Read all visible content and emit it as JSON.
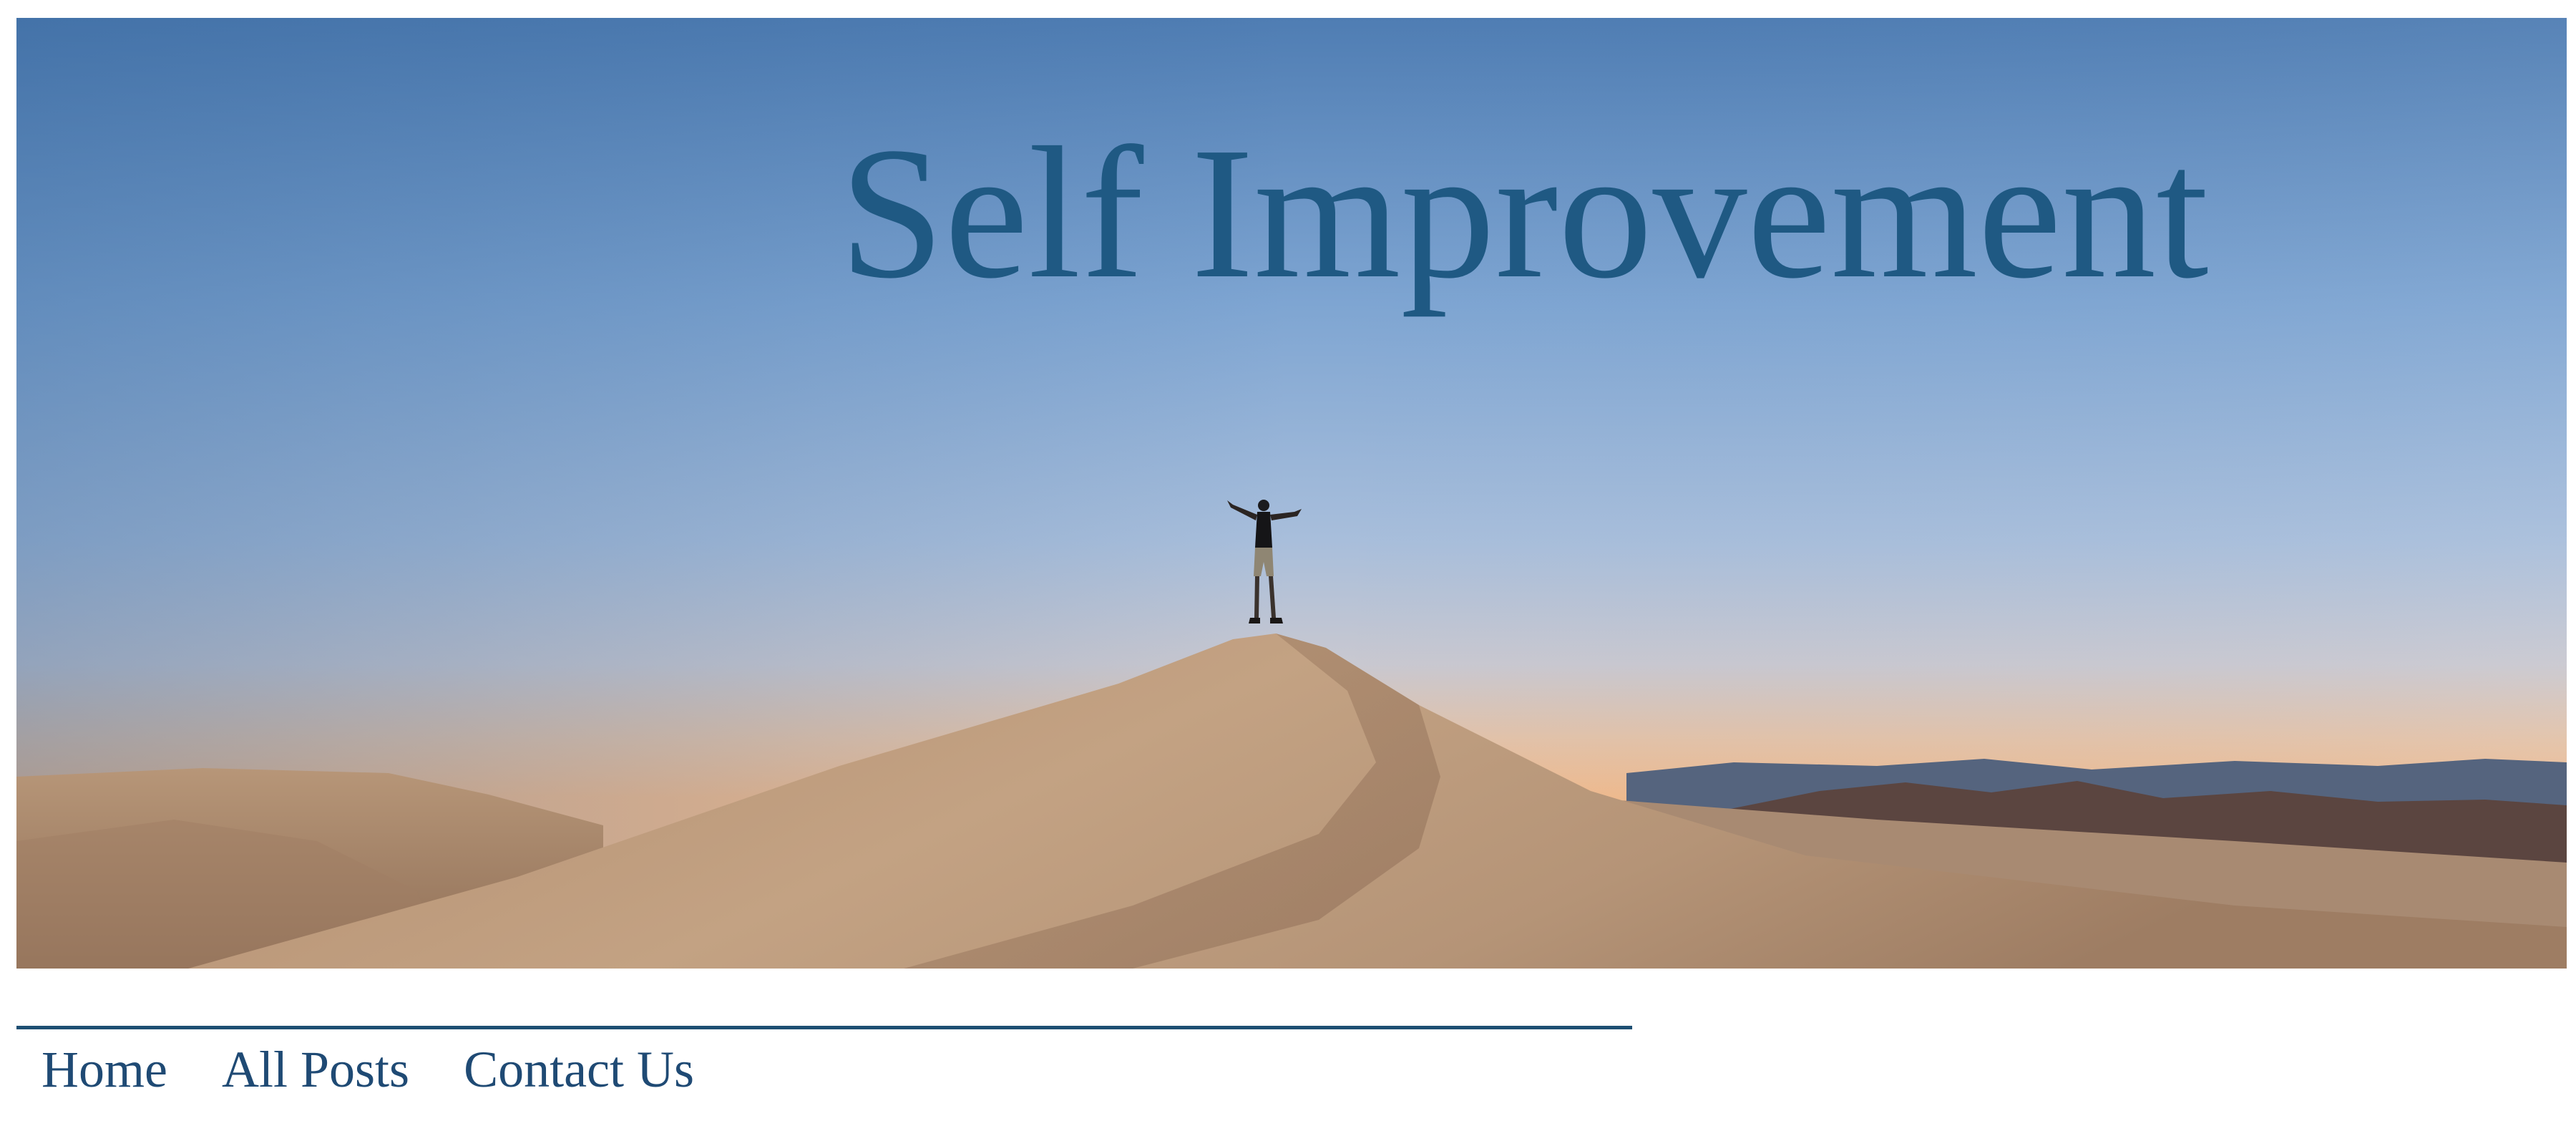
{
  "header": {
    "title": "Self Improvement",
    "title_color": "#1f5983",
    "banner_icon": "desert-dune-photo"
  },
  "nav": {
    "items": [
      {
        "label": "Home"
      },
      {
        "label": "All Posts"
      },
      {
        "label": "Contact Us"
      }
    ],
    "link_color": "#1f4a74",
    "rule_color": "#1d4f73"
  }
}
